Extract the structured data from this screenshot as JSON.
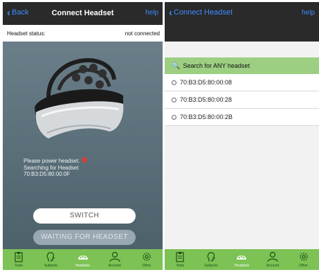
{
  "left": {
    "nav": {
      "back_label": "Back",
      "title": "Connect Headset",
      "help_label": "help"
    },
    "status": {
      "label": "Headset status:",
      "value": "not connected"
    },
    "message": {
      "line1": "Please power headset.",
      "line2": "Searching for Headset",
      "line3": "70:B3:D5:80:00:0F"
    },
    "buttons": {
      "switch": "SWITCH",
      "waiting": "WAITING FOR HEADSET"
    }
  },
  "right": {
    "nav": {
      "title": "Connect Headset",
      "help_label": "help"
    },
    "search_label": "Search for ANY headset",
    "devices": [
      "70:B3:D5:80:00:08",
      "70:B3:D5:80:00:28",
      "70:B3:D5:80:00:2B"
    ]
  },
  "tabs": [
    {
      "label": "Tests",
      "icon": "clipboard-icon"
    },
    {
      "label": "Subjects",
      "icon": "head-profile-icon"
    },
    {
      "label": "Headsets",
      "icon": "headset-icon"
    },
    {
      "label": "Account",
      "icon": "user-icon"
    },
    {
      "label": "Other",
      "icon": "gear-icon"
    }
  ],
  "colors": {
    "tabbar": "#7cc254",
    "search_row": "#9ccf82",
    "link": "#3c8cff",
    "error": "#e53935"
  }
}
